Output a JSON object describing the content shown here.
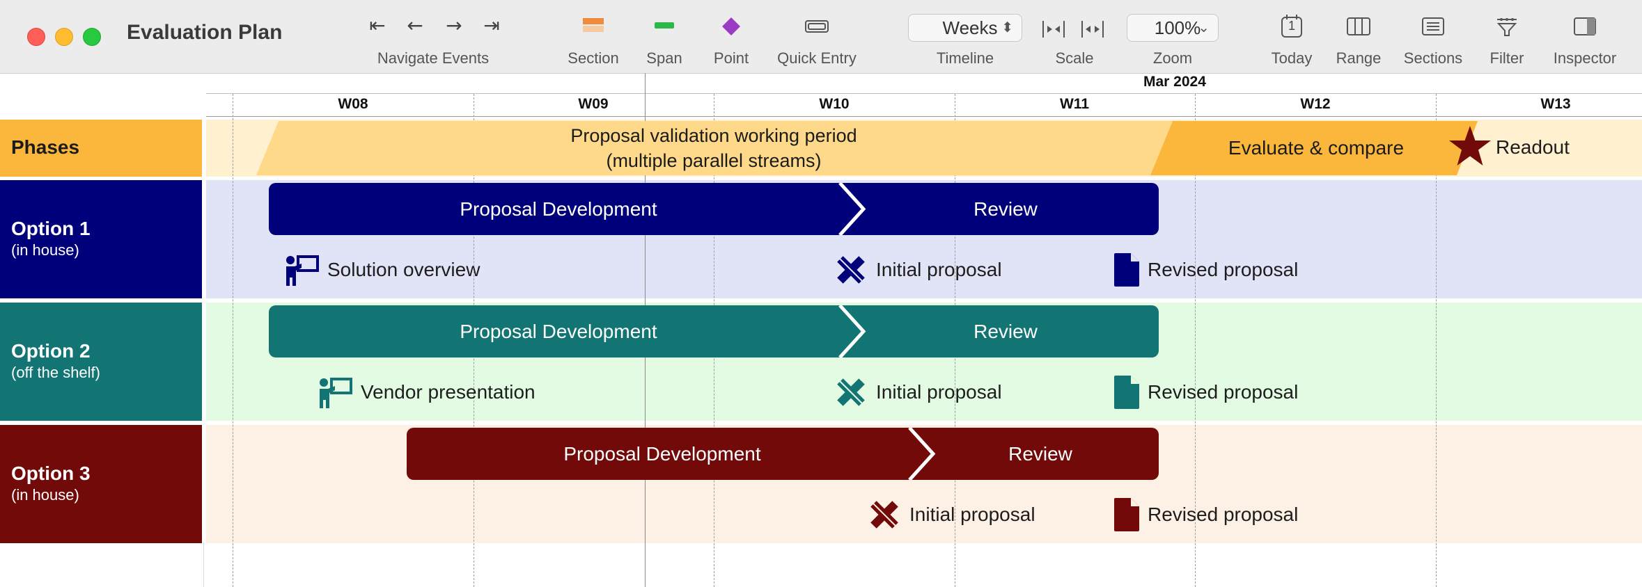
{
  "window": {
    "title": "Evaluation Plan"
  },
  "toolbar": {
    "navigate_label": "Navigate Events",
    "section_label": "Section",
    "span_label": "Span",
    "point_label": "Point",
    "quick_entry_label": "Quick Entry",
    "timeline_label": "Timeline",
    "timeline_value": "Weeks",
    "scale_label": "Scale",
    "zoom_label": "Zoom",
    "zoom_value": "100%",
    "today_label": "Today",
    "today_day": "1",
    "range_label": "Range",
    "sections_label": "Sections",
    "filter_label": "Filter",
    "inspector_label": "Inspector"
  },
  "timeline": {
    "month": "Mar 2024",
    "weeks": [
      "W08",
      "W09",
      "W10",
      "W11",
      "W12",
      "W13"
    ]
  },
  "colors": {
    "phases": "#fbb73c",
    "option1": "#00007a",
    "option2": "#137474",
    "option3": "#730a0a"
  },
  "phases": {
    "label": "Phases",
    "working_period_line1": "Proposal validation working period",
    "working_period_line2": "(multiple parallel streams)",
    "evaluate": "Evaluate & compare",
    "readout": "Readout"
  },
  "option1": {
    "title": "Option 1",
    "subtitle": "(in house)",
    "dev": "Proposal Development",
    "review": "Review",
    "milestone_a": "Solution overview",
    "milestone_b": "Initial proposal",
    "milestone_c": "Revised proposal"
  },
  "option2": {
    "title": "Option 2",
    "subtitle": "(off the shelf)",
    "dev": "Proposal Development",
    "review": "Review",
    "milestone_a": "Vendor presentation",
    "milestone_b": "Initial proposal",
    "milestone_c": "Revised proposal"
  },
  "option3": {
    "title": "Option 3",
    "subtitle": "(in house)",
    "dev": "Proposal Development",
    "review": "Review",
    "milestone_b": "Initial proposal",
    "milestone_c": "Revised proposal"
  }
}
